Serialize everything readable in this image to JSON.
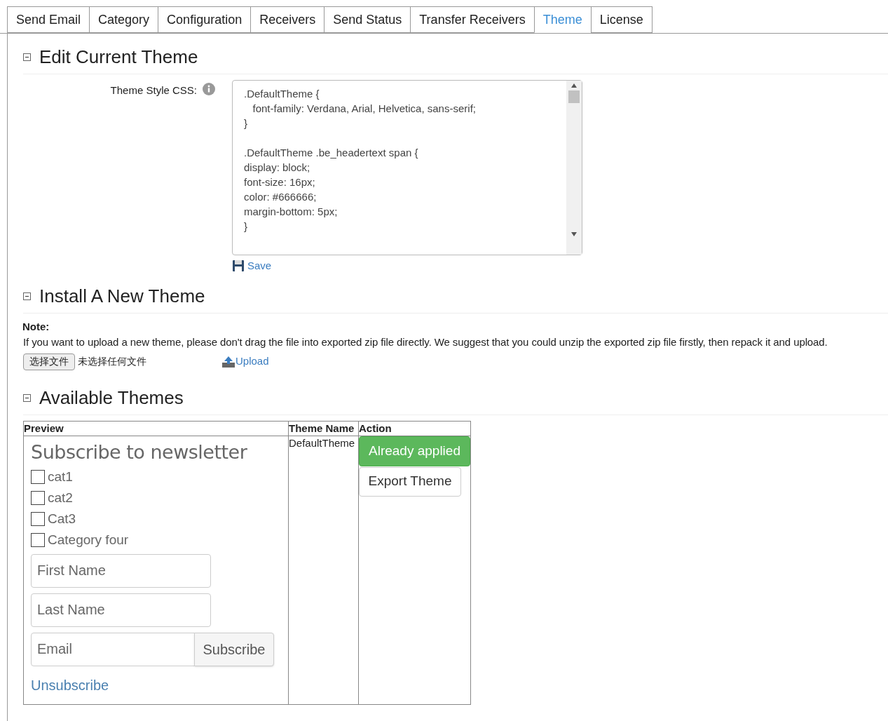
{
  "tabs": [
    {
      "label": "Send Email",
      "selected": false
    },
    {
      "label": "Category",
      "selected": false
    },
    {
      "label": "Configuration",
      "selected": false
    },
    {
      "label": "Receivers",
      "selected": false
    },
    {
      "label": "Send Status",
      "selected": false
    },
    {
      "label": "Transfer Receivers",
      "selected": false
    },
    {
      "label": "Theme",
      "selected": true
    },
    {
      "label": "License",
      "selected": false
    }
  ],
  "edit_section": {
    "title": "Edit Current Theme",
    "expanded": true,
    "field_label": "Theme Style CSS:",
    "css_blocks": [
      [
        ".DefaultTheme {",
        "   font-family: Verdana, Arial, Helvetica, sans-serif;",
        "}"
      ],
      [
        ".DefaultTheme .be_headertext span {",
        "display: block;",
        "font-size: 16px;",
        "color: #666666;",
        "margin-bottom: 5px;",
        "}"
      ]
    ],
    "save_link": "Save"
  },
  "install_section": {
    "title": "Install A New Theme",
    "expanded": true,
    "note_label": "Note:",
    "note": "If you want to upload a new theme, please don't drag the file into exported zip file directly. We suggest that you could unzip the exported zip file firstly, then repack it and upload.",
    "file_button": "选择文件",
    "file_status": "未选择任何文件",
    "upload_link": "Upload"
  },
  "themes_section": {
    "title": "Available Themes",
    "expanded": true,
    "table": {
      "columns": [
        "Preview",
        "Theme Name",
        "Action"
      ],
      "rows": [
        {
          "preview": {
            "heading": "Subscribe to newsletter",
            "categories": [
              {
                "label": "cat1",
                "checked": false
              },
              {
                "label": "cat2",
                "checked": false
              },
              {
                "label": "Cat3",
                "checked": false
              },
              {
                "label": "Category four",
                "checked": false
              }
            ],
            "first_name_placeholder": "First Name",
            "last_name_placeholder": "Last Name",
            "email_placeholder": "Email",
            "subscribe_button": "Subscribe",
            "unsubscribe_link": "Unsubscribe"
          },
          "theme_name": "DefaultTheme",
          "applied_button": "Already applied",
          "export_button": "Export Theme"
        }
      ]
    }
  }
}
